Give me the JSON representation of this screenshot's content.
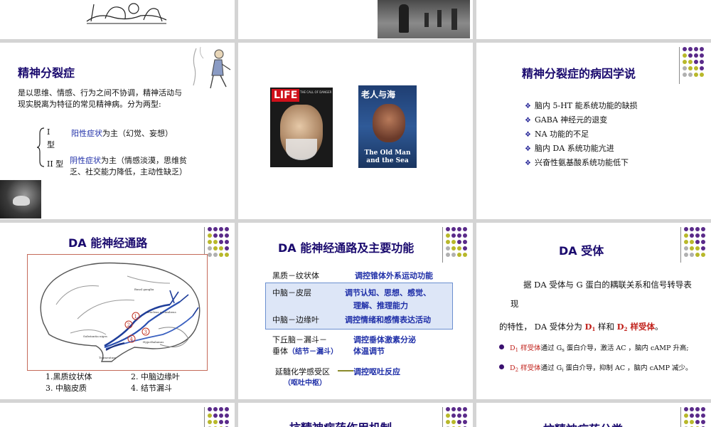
{
  "slides": {
    "schizo": {
      "title": "精神分裂症",
      "desc_line1": "是以思维、情感、行为之间不协调，精神活动与",
      "desc_line2": "现实脱离为特征的常见精神病。分为两型:",
      "type1_label_a": "I",
      "type1_label_b": "型",
      "type1_highlight": "阳性症状",
      "type1_rest": "为主（幻觉、妄想）",
      "type2_label": "II 型",
      "type2_highlight": "阴性症状",
      "type2_rest": "为主（情感淡漠，思维贫",
      "type2_line2": "乏、社交能力降低，主动性缺乏）"
    },
    "book": {
      "life_logo": "LIFE",
      "life_headline": "THE CALL OF DANGER",
      "cover_cn_title": "老人与海",
      "cover_en_title_1": "The Old Man",
      "cover_en_title_2": "and the Sea"
    },
    "cause": {
      "title": "精神分裂症的病因学说",
      "items": [
        {
          "text": "脑内 5-HT 能系统功能的缺损",
          "highlight": false
        },
        {
          "text": "GABA 神经元的退变",
          "highlight": false
        },
        {
          "text": "NA 功能的不足",
          "highlight": false
        },
        {
          "text": "脑内 DA 系统功能亢进",
          "highlight": true
        },
        {
          "text": "兴奋性氨基酸系统功能低下",
          "highlight": false
        }
      ]
    },
    "da_path": {
      "title": "DA 能神经通路",
      "legend": [
        "1.黑质纹状体",
        "2. 中脑边缘叶",
        "3. 中脑皮质",
        "4. 结节漏斗"
      ],
      "brain_labels": [
        "Basal ganglia",
        "Substantia nigra",
        "Tegmentum",
        "Nucleus accumbens",
        "Hypothalamus"
      ],
      "markers": [
        "1",
        "2",
        "3",
        "4"
      ]
    },
    "da_func": {
      "title": "DA 能神经通路及主要功能",
      "rows": [
        {
          "path": "黑质－纹状体",
          "func": "调控锥体外系运动功能"
        },
        {
          "path": "中脑－皮层",
          "func": "调节认知、思想、感觉、",
          "func2": "理解、推理能力"
        },
        {
          "path": "中脑－边缘叶",
          "func": "调控情绪和感情表达活动"
        },
        {
          "path": "下丘脑－漏斗－",
          "path2a": "垂体",
          "path2b": "（结节－漏斗）",
          "func": "调控垂体激素分泌",
          "func2": "体温调节"
        },
        {
          "path": "延髓化学感受区",
          "path2": "（呕吐中枢）",
          "func": "调控呕吐反应"
        }
      ]
    },
    "da_rec": {
      "title": "DA 受体",
      "p1_line1": "据 DA 受体与 G 蛋白的耦联关系和信号转导表",
      "p1_line2": "现",
      "p2_a": "的特性， DA 受体分为 ",
      "d1": "D",
      "d1_sub": "1",
      "p2_b": " 样和 ",
      "d2": "D",
      "d2_sub": "2",
      "p2_c": " 样受体",
      "p2_d": "。",
      "b1_label": "D",
      "b1_sub": "1",
      "b1_label_rest": " 样受体",
      "b1_text_a": "通过 G",
      "b1_gsub": "s",
      "b1_text_b": " 蛋白介导，激活 AC ，脑内 cAMP 升高;",
      "b2_label": "D",
      "b2_sub": "2",
      "b2_label_rest": " 样受体",
      "b2_text_a": "通过 G",
      "b2_gsub": "i",
      "b2_text_b": " 蛋白介导，抑制 AC ，脑内 cAMP 减少。"
    },
    "bottom": {
      "mid_title": "抗精神病药作用机制",
      "right_title": "抗精神病药分类"
    }
  },
  "colors": {
    "title": "#1a0a6e",
    "highlight_blue": "#1f2fa8",
    "receptor_red": "#c0201a",
    "dot_purple": "#5a2a8a",
    "dot_olive": "#b8b82a",
    "dot_gray": "#b0b0b0",
    "box_bg": "#dde6f7",
    "box_border": "#6b8fd0"
  }
}
